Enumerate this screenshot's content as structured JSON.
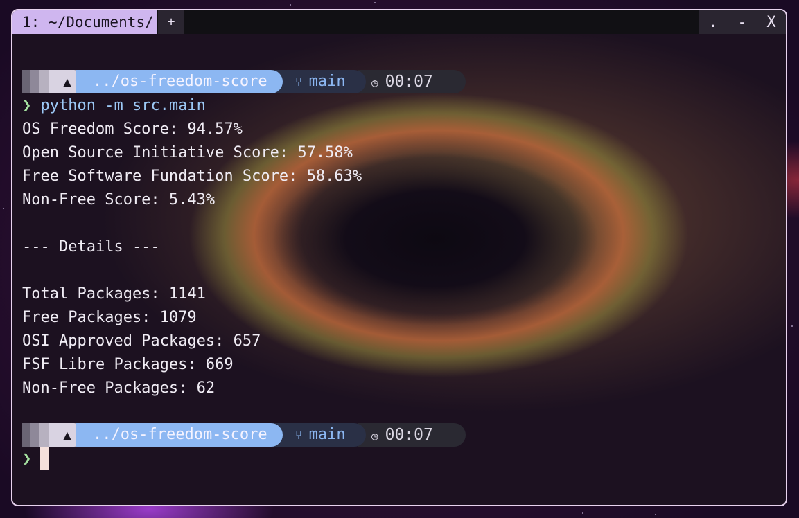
{
  "tab_bar": {
    "active_tab_label": "1: ~/Documents/",
    "new_tab_label": "+",
    "controls": [
      ".",
      "-",
      "X"
    ]
  },
  "prompts": [
    {
      "os_icon": "arch-linux-icon",
      "os_glyph": "▲",
      "directory": "../os-freedom-score",
      "branch_icon": "git-branch-icon",
      "branch": "main",
      "clock_icon": "clock-icon",
      "elapsed": "00:07"
    },
    {
      "os_icon": "arch-linux-icon",
      "os_glyph": "▲",
      "directory": "../os-freedom-score",
      "branch_icon": "git-branch-icon",
      "branch": "main",
      "clock_icon": "clock-icon",
      "elapsed": "00:07"
    }
  ],
  "command": {
    "symbol": "❯",
    "text": "python -m src.main"
  },
  "output": [
    "OS Freedom Score: 94.57%",
    "Open Source Initiative Score: 57.58%",
    "Free Software Fundation Score: 58.63%",
    "Non-Free Score: 5.43%",
    "",
    "--- Details ---",
    "",
    "Total Packages: 1141",
    "Free Packages: 1079",
    "OSI Approved Packages: 657",
    "FSF Libre Packages: 669",
    "Non-Free Packages: 62"
  ],
  "second_prompt_symbol": "❯",
  "colors": {
    "tab_active": "#cfb6ef",
    "directory_segment": "#8cb7f2",
    "prompt_symbol": "#a6e3a1",
    "window_border": "#e8d3ee"
  }
}
